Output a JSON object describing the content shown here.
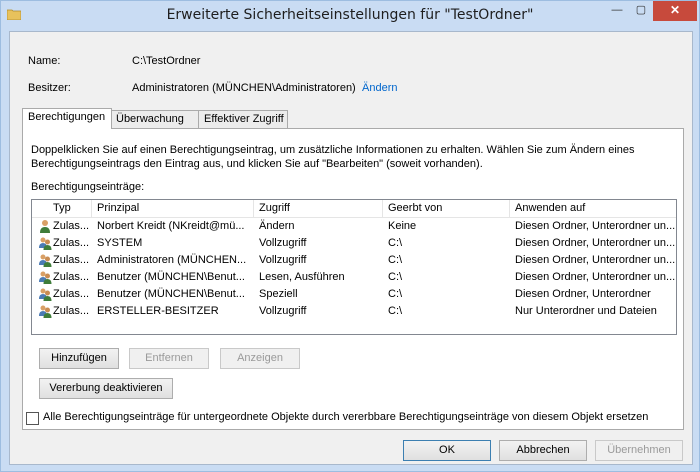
{
  "window": {
    "title": "Erweiterte Sicherheitseinstellungen für \"TestOrdner\"",
    "minimize": "—",
    "maximize": "▢",
    "close": "✕"
  },
  "info": {
    "name_label": "Name:",
    "name_value": "C:\\TestOrdner",
    "owner_label": "Besitzer:",
    "owner_value": "Administratoren (MÜNCHEN\\Administratoren)",
    "owner_change": "Ändern"
  },
  "tabs": [
    "Berechtigungen",
    "Überwachung",
    "Effektiver Zugriff"
  ],
  "description_line1": "Doppelklicken Sie auf einen Berechtigungseintrag, um zusätzliche Informationen zu erhalten. Wählen Sie zum Ändern eines",
  "description_line2": "Berechtigungseintrags den Eintrag aus, und klicken Sie auf \"Bearbeiten\" (soweit vorhanden).",
  "entries_label": "Berechtigungseinträge:",
  "columns": [
    "Typ",
    "Prinzipal",
    "Zugriff",
    "Geerbt von",
    "Anwenden auf"
  ],
  "rows": [
    {
      "icon": "single-user-icon",
      "type": "Zulas...",
      "principal": "Norbert Kreidt (NKreidt@mü...",
      "access": "Ändern",
      "inherited": "Keine",
      "applies": "Diesen Ordner, Unterordner un..."
    },
    {
      "icon": "group-users-icon",
      "type": "Zulas...",
      "principal": "SYSTEM",
      "access": "Vollzugriff",
      "inherited": "C:\\",
      "applies": "Diesen Ordner, Unterordner un..."
    },
    {
      "icon": "group-users-icon",
      "type": "Zulas...",
      "principal": "Administratoren (MÜNCHEN...",
      "access": "Vollzugriff",
      "inherited": "C:\\",
      "applies": "Diesen Ordner, Unterordner un..."
    },
    {
      "icon": "group-users-icon",
      "type": "Zulas...",
      "principal": "Benutzer (MÜNCHEN\\Benut...",
      "access": "Lesen, Ausführen",
      "inherited": "C:\\",
      "applies": "Diesen Ordner, Unterordner un..."
    },
    {
      "icon": "group-users-icon",
      "type": "Zulas...",
      "principal": "Benutzer (MÜNCHEN\\Benut...",
      "access": "Speziell",
      "inherited": "C:\\",
      "applies": "Diesen Ordner, Unterordner"
    },
    {
      "icon": "group-users-icon",
      "type": "Zulas...",
      "principal": "ERSTELLER-BESITZER",
      "access": "Vollzugriff",
      "inherited": "C:\\",
      "applies": "Nur Unterordner und Dateien"
    }
  ],
  "buttons": {
    "add": "Hinzufügen",
    "remove": "Entfernen",
    "view": "Anzeigen",
    "disable_inheritance": "Vererbung deaktivieren",
    "ok": "OK",
    "cancel": "Abbrechen",
    "apply": "Übernehmen"
  },
  "replace_checkbox_label": "Alle Berechtigungseinträge für untergeordnete Objekte durch vererbbare Berechtigungseinträge von diesem Objekt ersetzen",
  "colors": {
    "titlebar": "#c9dcf3",
    "close": "#c74a3c",
    "link": "#0066cc"
  }
}
